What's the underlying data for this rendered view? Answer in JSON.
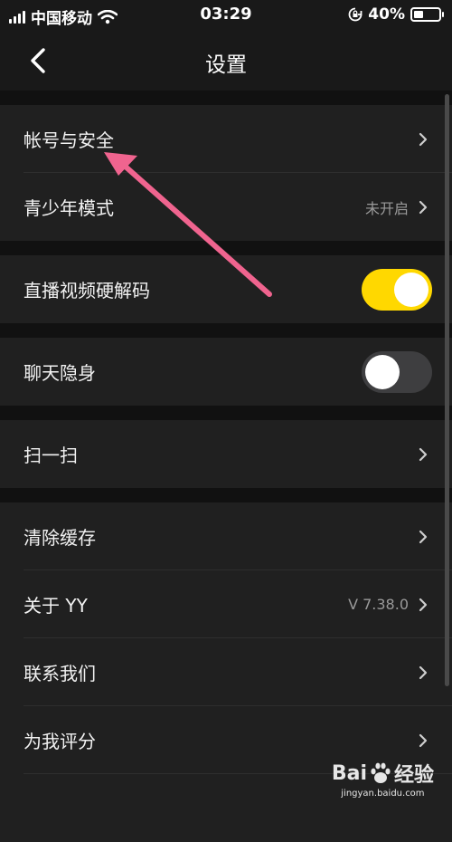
{
  "status_bar": {
    "carrier": "中国移动",
    "time": "03:29",
    "battery": "40%",
    "battery_level": 0.4
  },
  "nav": {
    "title": "设置"
  },
  "settings": {
    "account_security": "帐号与安全",
    "youth_mode": "青少年模式",
    "youth_mode_value": "未开启",
    "hw_decode": "直播视频硬解码",
    "hw_decode_on": true,
    "chat_invisible": "聊天隐身",
    "chat_invisible_on": false,
    "scan": "扫一扫",
    "clear_cache": "清除缓存",
    "about": "关于 YY",
    "about_version": "V 7.38.0",
    "contact_us": "联系我们",
    "rate_us": "为我评分"
  },
  "watermark": {
    "brand_left": "Bai",
    "brand_right": "经验",
    "url": "jingyan.baidu.com"
  },
  "colors": {
    "toggle_on": "#ffd800",
    "annotation_arrow": "#f0648f",
    "row_bg": "#202020",
    "page_bg": "#111111"
  },
  "icons": [
    "signal-icon",
    "wifi-icon",
    "rotation-lock-icon",
    "battery-icon",
    "back-chevron-icon",
    "chevron-right-icon",
    "baidu-paw-icon"
  ]
}
